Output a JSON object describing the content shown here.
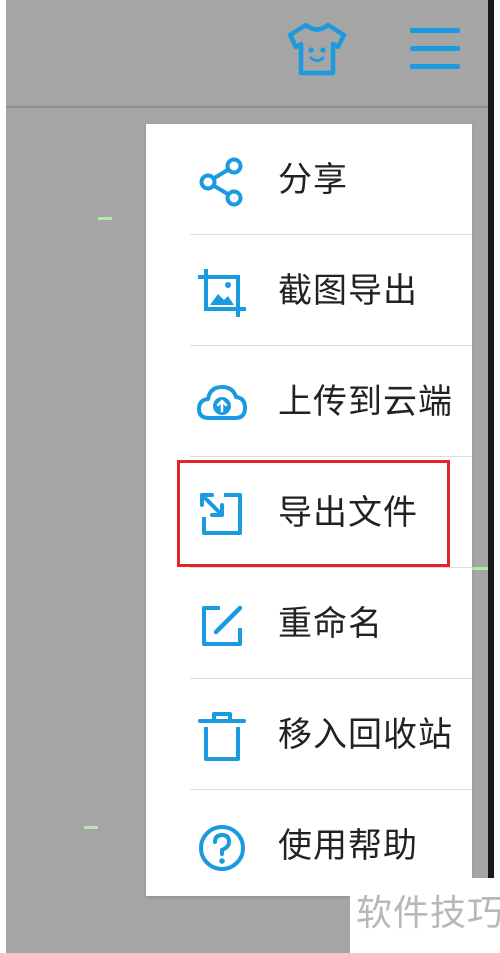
{
  "colors": {
    "accent": "#1a9be0",
    "highlight_border": "#e3242b",
    "background_gray": "#a5a5a5"
  },
  "toolbar": {
    "icons": [
      "tshirt-icon",
      "hamburger-menu-icon"
    ]
  },
  "menu": {
    "items": [
      {
        "label": "分享",
        "icon": "share-icon"
      },
      {
        "label": "截图导出",
        "icon": "screenshot-export-icon"
      },
      {
        "label": "上传到云端",
        "icon": "cloud-upload-icon"
      },
      {
        "label": "导出文件",
        "icon": "export-file-icon",
        "highlighted": true
      },
      {
        "label": "重命名",
        "icon": "edit-icon"
      },
      {
        "label": "移入回收站",
        "icon": "trash-icon"
      },
      {
        "label": "使用帮助",
        "icon": "help-icon"
      }
    ]
  },
  "watermark": {
    "text": "软件技巧"
  }
}
